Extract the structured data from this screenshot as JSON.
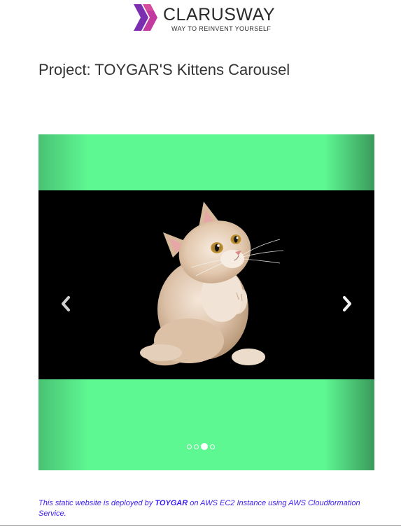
{
  "header": {
    "brand_name": "CLARUSWAY",
    "tagline": "WAY TO REINVENT YOURSELF",
    "logo_icon": "chevron-arrows-logo",
    "colors": {
      "logo_primary": "#6f2aa6",
      "logo_secondary": "#c0359a",
      "text": "#2b2b2b"
    }
  },
  "page": {
    "title": "Project: TOYGAR'S Kittens Carousel"
  },
  "carousel": {
    "slide_image": "kitten-photo",
    "slide_alt": "kitten",
    "background_color": "#5ef893",
    "prev_icon": "chevron-left-icon",
    "next_icon": "chevron-right-icon",
    "indicators": [
      {
        "active": false
      },
      {
        "active": false
      },
      {
        "active": true
      },
      {
        "active": false
      }
    ],
    "active_index": 2,
    "slide_count": 4
  },
  "footer": {
    "text_before": "This static website is deployed by ",
    "author": "TOYGAR",
    "text_after": " on AWS EC2 Instance using AWS Cloudformation Service.",
    "color": "#3a1cf0"
  }
}
